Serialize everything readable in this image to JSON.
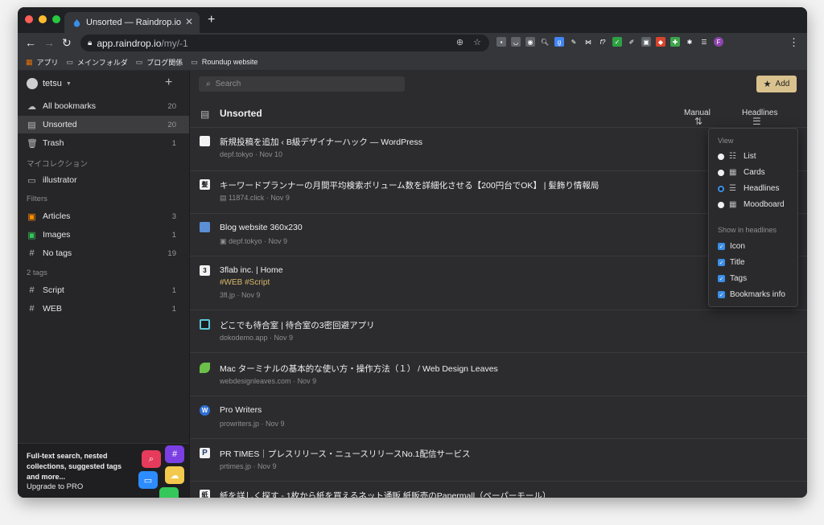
{
  "browser": {
    "tab_title": "Unsorted — Raindrop.io",
    "url_host": "app.raindrop.io",
    "url_path": "/my/-1",
    "bookmarks_bar": [
      "アプリ",
      "メインフォルダ",
      "ブログ関係",
      "Roundup website"
    ],
    "colors": {
      "close": "#ff5f57",
      "minimize": "#febc2e",
      "maximize": "#28c840"
    }
  },
  "sidebar": {
    "user": "tetsu",
    "items": [
      {
        "label": "All bookmarks",
        "count": "20",
        "icon": "cloud-icon"
      },
      {
        "label": "Unsorted",
        "count": "20",
        "icon": "inbox-icon",
        "active": true
      },
      {
        "label": "Trash",
        "count": "1",
        "icon": "trash-icon"
      }
    ],
    "collections_title": "マイコレクション",
    "collections": [
      {
        "label": "illustrator",
        "icon": "folder-icon"
      }
    ],
    "filters_title": "Filters",
    "filters": [
      {
        "label": "Articles",
        "count": "3",
        "color": "#ff8c00"
      },
      {
        "label": "Images",
        "count": "1",
        "color": "#34c759"
      },
      {
        "label": "No tags",
        "count": "19"
      }
    ],
    "tags_title": "2 tags",
    "tags": [
      {
        "label": "Script",
        "count": "1"
      },
      {
        "label": "WEB",
        "count": "1"
      }
    ],
    "promo": {
      "text": "Full-text search, nested collections, suggested tags and more...",
      "upgrade": "Upgrade to PRO"
    }
  },
  "main": {
    "search_placeholder": "Search",
    "add_label": "Add",
    "title": "Unsorted",
    "sort_label": "Manual",
    "view_label": "Headlines",
    "bookmarks": [
      {
        "title": "新規投稿を追加 ‹ B級デザイナーハック — WordPress",
        "domain": "depf.tokyo",
        "date": "Nov 10"
      },
      {
        "title": "キーワードプランナーの月間平均検索ボリューム数を詳細化させる【200円台でOK】 | 髪飾り情報局",
        "domain": "11874.click",
        "date": "Nov 9"
      },
      {
        "title": "Blog website 360x230",
        "domain": "depf.tokyo",
        "date": "Nov 9"
      },
      {
        "title": "3flab inc. | Home",
        "tags": "#WEB  #Script",
        "domain": "3fl.jp",
        "date": "Nov 9"
      },
      {
        "title": "どこでも待合室 | 待合室の3密回避アプリ",
        "domain": "dokodemo.app",
        "date": "Nov 9"
      },
      {
        "title": "Mac ターミナルの基本的な使い方・操作方法（１） / Web Design Leaves",
        "domain": "webdesignleaves.com",
        "date": "Nov 9"
      },
      {
        "title": "Pro Writers",
        "domain": "prowriters.jp",
        "date": "Nov 9"
      },
      {
        "title": "PR TIMES｜プレスリリース・ニュースリリースNo.1配信サービス",
        "domain": "prtimes.jp",
        "date": "Nov 9"
      },
      {
        "title": "紙を詳しく探す - 1枚から紙を買えるネット通販 紙販売のPapermall（ペーパーモール）",
        "domain": "",
        "date": ""
      }
    ]
  },
  "view_menu": {
    "view_title": "View",
    "views": [
      "List",
      "Cards",
      "Headlines",
      "Moodboard"
    ],
    "selected": "Headlines",
    "show_title": "Show in headlines",
    "show": [
      "Icon",
      "Title",
      "Tags",
      "Bookmarks info"
    ]
  }
}
